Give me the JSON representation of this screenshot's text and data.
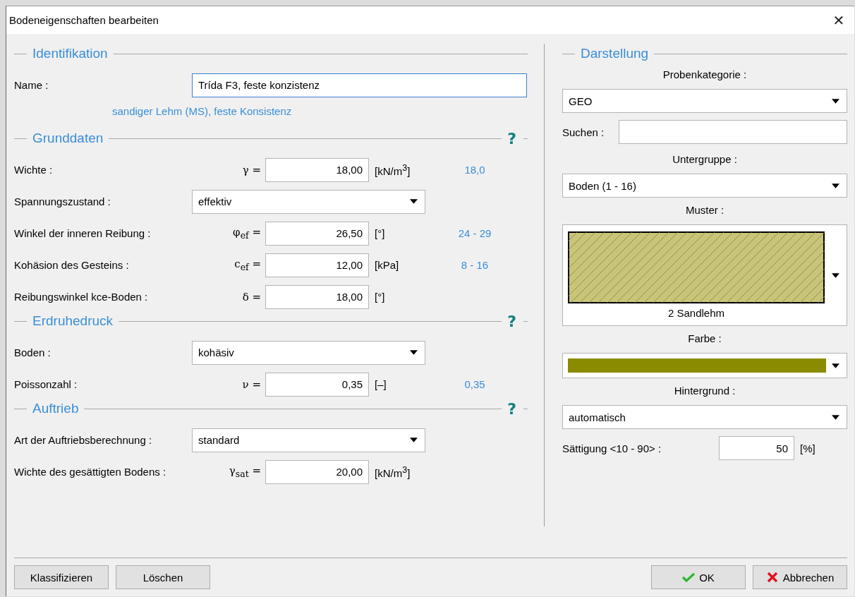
{
  "window": {
    "title": "Bodeneigenschaften bearbeiten",
    "close": "✕"
  },
  "identification": {
    "title": "Identifikation",
    "label": "Name :",
    "value": "Trída F3, feste konzistenz",
    "hint": "sandiger Lehm (MS), feste Konsistenz"
  },
  "sections": [
    {
      "title": "Grunddaten",
      "help": "?",
      "rows": [
        {
          "kind": "number",
          "label": "Wichte :",
          "symbol": "γ =",
          "value": "18,00",
          "unit": "[kN/m$^{3}$]",
          "hint": "18,0"
        },
        {
          "kind": "select",
          "label": "Spannungszustand :",
          "value": "effektiv"
        },
        {
          "kind": "number",
          "label": "Winkel der inneren Reibung :",
          "symbol": "φ$_{ef}$ =",
          "value": "26,50",
          "unit": "[°]",
          "hint": "24 - 29"
        },
        {
          "kind": "number",
          "label": "Kohäsion des Gesteins :",
          "symbol": "c$_{ef}$ =",
          "value": "12,00",
          "unit": "[kPa]",
          "hint": "8 - 16"
        },
        {
          "kind": "number",
          "label": "Reibungswinkel kce-Boden :",
          "symbol": "δ =",
          "value": "18,00",
          "unit": "[°]"
        }
      ]
    },
    {
      "title": "Erdruhedruck",
      "help": "?",
      "rows": [
        {
          "kind": "select",
          "label": "Boden :",
          "value": "kohäsiv"
        },
        {
          "kind": "number",
          "label": "Poissonzahl :",
          "symbol": "ν =",
          "value": "0,35",
          "unit": "[–]",
          "hint": "0,35"
        }
      ]
    },
    {
      "title": "Auftrieb",
      "help": "?",
      "rows": [
        {
          "kind": "select",
          "label": "Art der Auftriebsberechnung :",
          "value": "standard"
        },
        {
          "kind": "number",
          "label": "Wichte des gesättigten Bodens :",
          "symbol": "γ$_{sat}$ =",
          "value": "20,00",
          "unit": "[kN/m$^{3}$]"
        }
      ]
    }
  ],
  "display": {
    "title": "Darstellung",
    "items": [
      {
        "kind": "select",
        "label": "Probenkategorie :",
        "value": "GEO"
      },
      {
        "kind": "search",
        "label": "Suchen :"
      },
      {
        "kind": "select",
        "label": "Untergruppe :",
        "value": "Boden (1 - 16)"
      },
      {
        "kind": "pattern",
        "label": "Muster :",
        "caption": "2 Sandlehm"
      },
      {
        "kind": "color",
        "label": "Farbe :",
        "color": "#8b8b00"
      },
      {
        "kind": "select",
        "label": "Hintergrund :",
        "value": "automatisch"
      },
      {
        "kind": "number",
        "label": "Sättigung <10 - 90> :",
        "value": "50",
        "unit": "[%]"
      }
    ]
  },
  "buttons": [
    {
      "kind": "plain",
      "label": "Klassifizieren"
    },
    {
      "kind": "plain",
      "label": "Löschen"
    },
    {
      "kind": "ok",
      "label": "OK"
    },
    {
      "kind": "cancel",
      "label": "Abbrechen"
    }
  ]
}
